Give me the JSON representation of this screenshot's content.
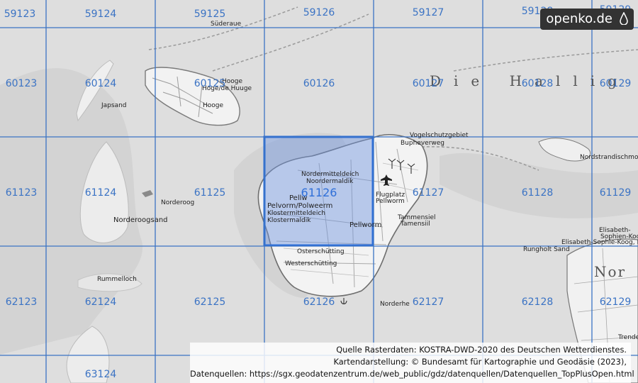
{
  "logo": {
    "text": "openko.de"
  },
  "grid": {
    "selected": "61126",
    "cells": [
      [
        "59123",
        "59124",
        "59125",
        "59126",
        "59127",
        "59128",
        "59129"
      ],
      [
        "60123",
        "60124",
        "60125",
        "60126",
        "60127",
        "60128",
        "60129"
      ],
      [
        "61123",
        "61124",
        "61125",
        "61126",
        "61127",
        "61128",
        "61129"
      ],
      [
        "62123",
        "62124",
        "62125",
        "62126",
        "62127",
        "62128",
        "62129"
      ],
      [
        "63124"
      ]
    ]
  },
  "places": {
    "suderaue": "Süderaue",
    "hooge": "Hooge",
    "hooge_frisian": "Hoge/de Huuge",
    "hooge_small": "Hooge",
    "japsand": "Japsand",
    "norderoog": "Norderoog",
    "norderoogsand": "Norderoogsand",
    "rummelloch": "Rummelloch",
    "nordermitteldeich": "Nordermitteldeich",
    "nordermitteldeich_fr": "Noordermaldik",
    "pellworm_town": "Pellw",
    "pelvorm": "Pelvorm/Polweerm",
    "klostermitteldeich": "Klostermitteldeich",
    "klostermitteldeich_fr": "Klostermaldik",
    "pellworm": "Pellworm",
    "osterschutting": "Osterschütting",
    "westerschutting": "Westerschütting",
    "norderhe": "Norderhe",
    "vogelschutzgebiet": "Vogelschutzgebiet",
    "bupheverweg": "Bupheverweg",
    "flugplatz": "Flugplatz",
    "flugplatz_fr": "Pellworm",
    "tammensiel": "Tammensiel",
    "tammensiel_fr": "Tamensiil",
    "die_hallig": "Die Hallig",
    "nordstrandischmoor": "Nordstrandischmoor",
    "elisabeth": "Elisabeth-",
    "elisabeth2": "Sophien-Koog",
    "elisabeth3": "Elisabeth-Sophie-Koog, Elisabeth-Sop",
    "rungholt": "Rungholt Sand",
    "nor": "Nor",
    "trende": "Trende"
  },
  "attribution": {
    "line1": "Quelle Rasterdaten: KOSTRA-DWD-2020 des Deutschen Wetterdienstes.",
    "line2": "Kartendarstellung: © Bundesamt für Kartographie und Geodäsie (2023),",
    "line3": "Datenquellen: https://sgx.geodatenzentrum.de/web_public/gdz/datenquellen/Datenquellen_TopPlusOpen.html"
  },
  "colors": {
    "grid": "#3b73c4",
    "selected_fill": "#6f95e0",
    "selected_stroke": "#2f6fd8",
    "water": "#dedede",
    "land": "#f2f2f2"
  }
}
